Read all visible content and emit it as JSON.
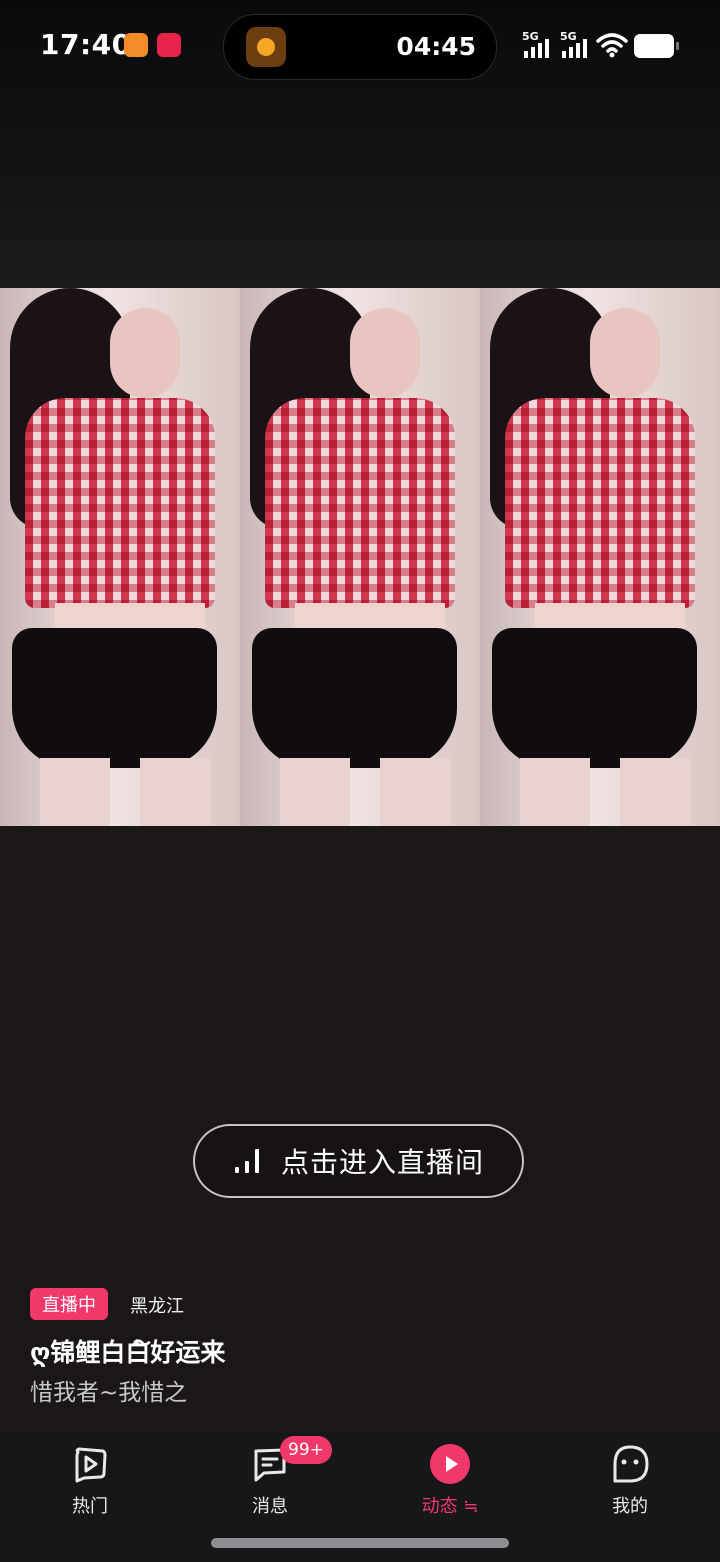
{
  "status_bar": {
    "time": "17:40",
    "island_time": "04:45",
    "signal1_label": "5G",
    "signal2_label": "5G",
    "icons": [
      "app-orange-icon",
      "app-red-icon",
      "timer-icon",
      "signal-icon",
      "wifi-icon",
      "battery-icon"
    ]
  },
  "video": {
    "panels": 3
  },
  "enter_button": {
    "label": "点击进入直播间",
    "icon": "live-bars-icon"
  },
  "live_info": {
    "badge": "直播中",
    "location": "黑龙江",
    "streamer_name": "ღ锦鲤白白໌好运来",
    "signature": "惜我者~我惜之"
  },
  "tabbar": {
    "tabs": [
      {
        "label": "热门",
        "icon": "play-square-icon",
        "active": false
      },
      {
        "label": "消息",
        "icon": "chat-bubble-icon",
        "active": false,
        "badge": "99+"
      },
      {
        "label": "动态 ≒",
        "icon": "play-circle-icon",
        "active": true
      },
      {
        "label": "我的",
        "icon": "face-icon",
        "active": false
      }
    ]
  },
  "colors": {
    "accent": "#f0386b",
    "tabbar_bg": "#17171a",
    "background": "#0b0908"
  }
}
